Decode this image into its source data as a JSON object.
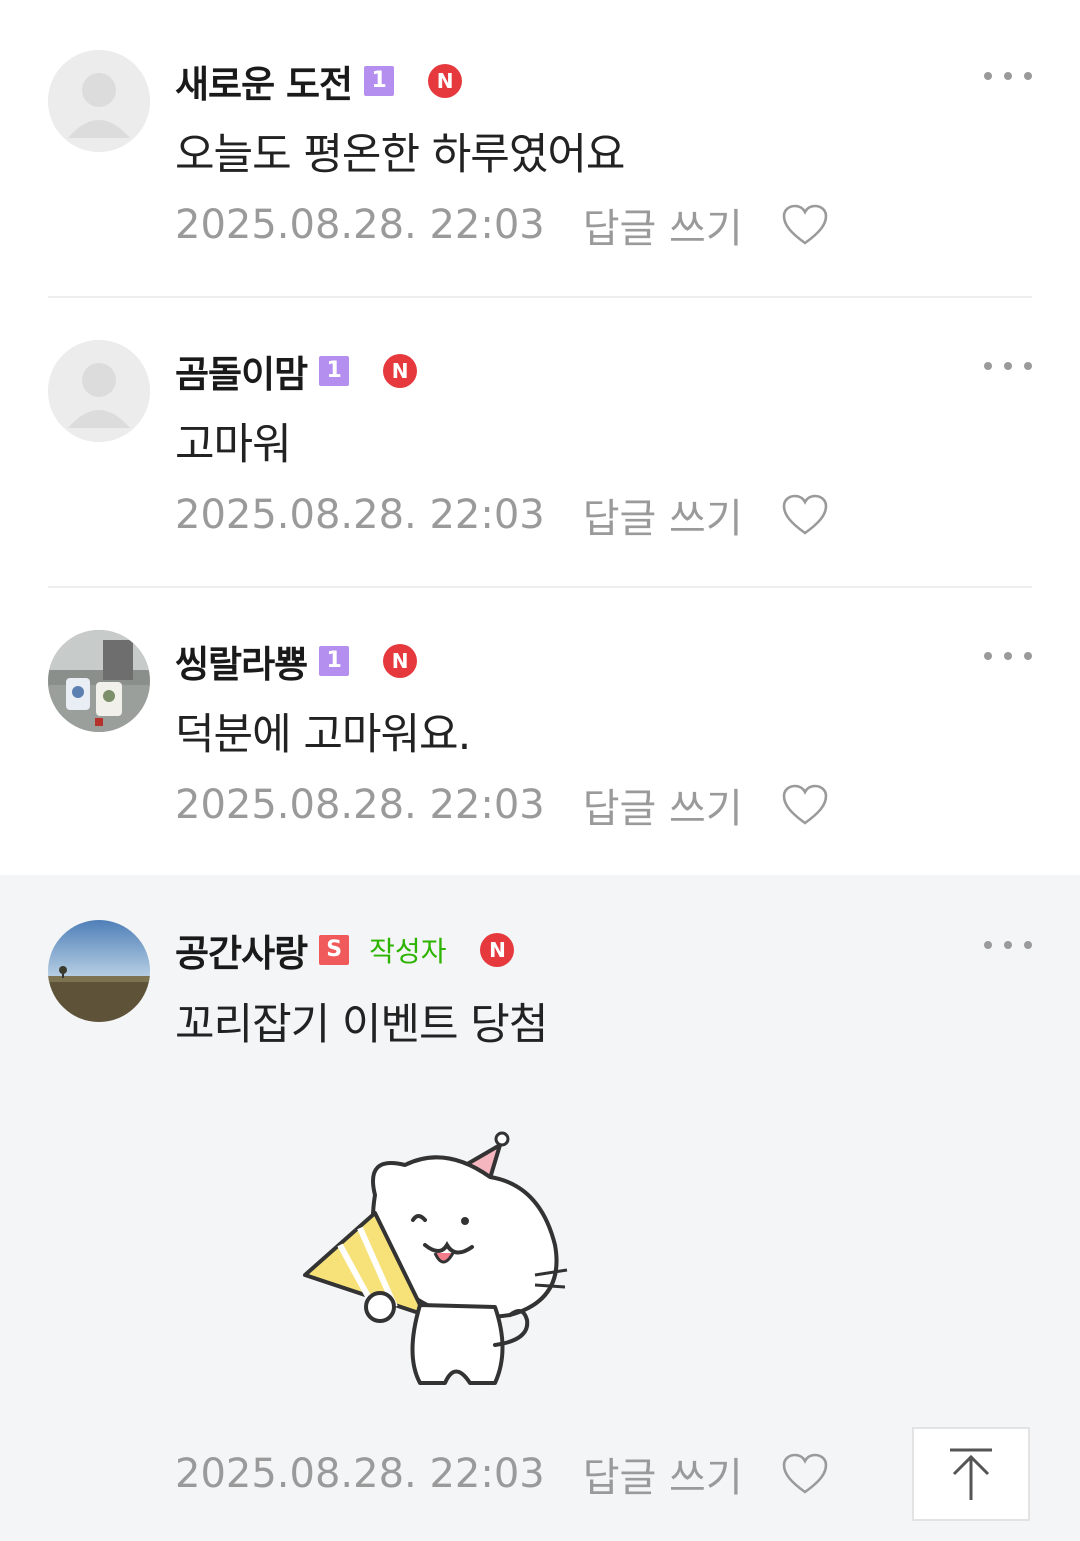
{
  "comments": [
    {
      "author": "새로운 도전",
      "level_badge": "1",
      "new_badge": "N",
      "text": "오늘도 평온한 하루였어요",
      "date": "2025.08.28. 22:03",
      "reply_label": "답글 쓰기",
      "avatar_icon": "default-avatar-icon"
    },
    {
      "author": "곰돌이맘",
      "level_badge": "1",
      "new_badge": "N",
      "text": "고마워",
      "date": "2025.08.28. 22:03",
      "reply_label": "답글 쓰기",
      "avatar_icon": "default-avatar-icon"
    },
    {
      "author": "씽랄라뿅",
      "level_badge": "1",
      "new_badge": "N",
      "text": "덕분에 고마워요.",
      "date": "2025.08.28. 22:03",
      "reply_label": "답글 쓰기",
      "avatar_icon": "photo-avatar-mugs"
    },
    {
      "author": "공간사랑",
      "level_badge": "S",
      "writer_tag": "작성자",
      "new_badge": "N",
      "text": "꼬리잡기 이벤트 당첨",
      "date": "2025.08.28. 22:03",
      "reply_label": "답글 쓰기",
      "avatar_icon": "photo-avatar-field",
      "sticker": "cat-party-sticker"
    }
  ],
  "colors": {
    "new_badge": "#e5393e",
    "level_badge": "#b58ff0",
    "writer_tag": "#2db400",
    "meta_text": "#9a9a9a",
    "highlight_bg": "#f4f5f7"
  },
  "top_button_icon": "arrow-up-to-top-icon"
}
